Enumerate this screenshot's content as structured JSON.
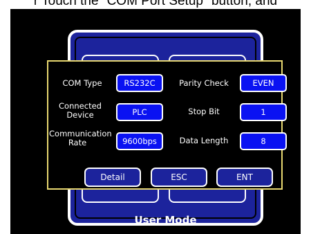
{
  "caption": "r Touch the \"COM Port Setup\" button, and",
  "background_menu": {
    "label": "User Mode"
  },
  "dialog": {
    "fields": {
      "com_type": {
        "label": "COM Type",
        "value": "RS232C"
      },
      "parity_check": {
        "label": "Parity Check",
        "value": "EVEN"
      },
      "connected_device": {
        "label": "Connected Device",
        "value": "PLC"
      },
      "stop_bit": {
        "label": "Stop Bit",
        "value": "1"
      },
      "communication_rate": {
        "label": "Communication Rate",
        "value": "9600bps"
      },
      "data_length": {
        "label": "Data Length",
        "value": "8"
      }
    },
    "buttons": {
      "detail": "Detail",
      "esc": "ESC",
      "ent": "ENT"
    }
  },
  "colors": {
    "value_blue": "#0a12f2",
    "button_blue": "#1c239c",
    "dialog_border": "#e8d870",
    "background": "#000000"
  }
}
